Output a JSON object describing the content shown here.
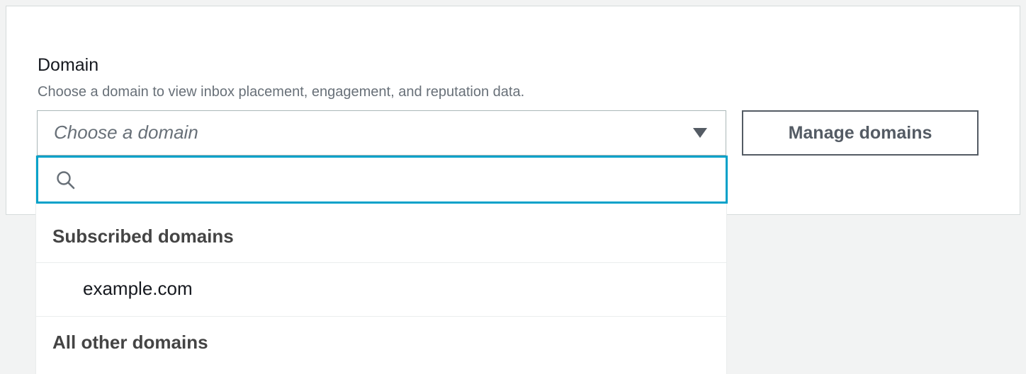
{
  "domain_field": {
    "label": "Domain",
    "description": "Choose a domain to view inbox placement, engagement, and reputation data.",
    "select": {
      "placeholder": "Choose a domain",
      "caret_icon": "caret-down-icon"
    },
    "manage_button_label": "Manage domains"
  },
  "dropdown": {
    "search": {
      "icon": "search-icon",
      "value": "",
      "placeholder": ""
    },
    "groups": [
      {
        "label": "Subscribed domains",
        "options": [
          "example.com"
        ]
      },
      {
        "label": "All other domains",
        "options": []
      }
    ]
  },
  "colors": {
    "focus_border": "#00a1c9",
    "secondary_text": "#687078",
    "button_border": "#545b64"
  }
}
